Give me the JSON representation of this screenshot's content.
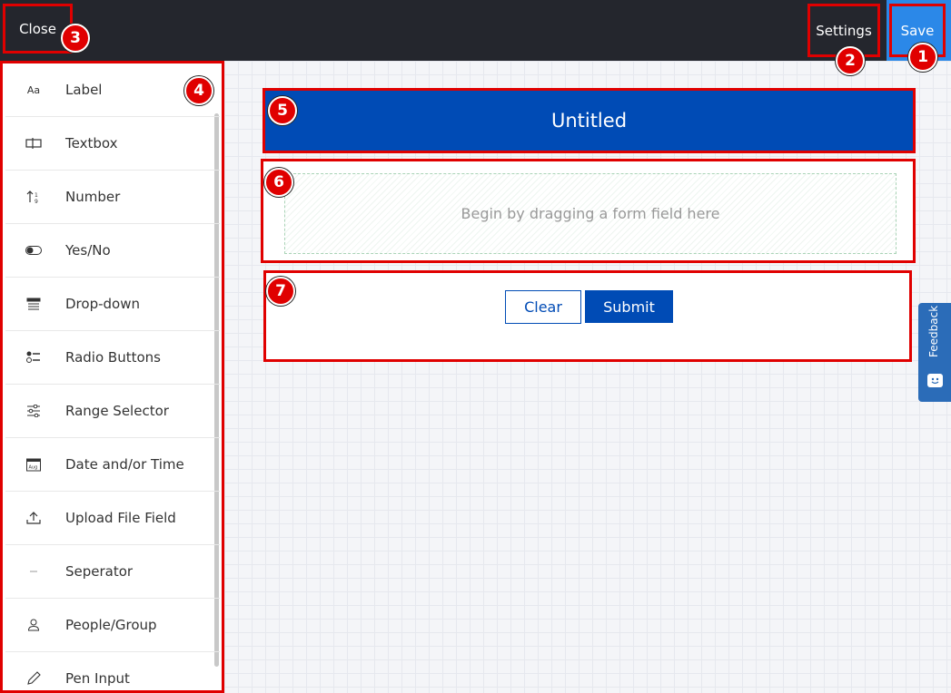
{
  "topbar": {
    "close_label": "Close",
    "settings_label": "Settings",
    "save_label": "Save"
  },
  "badges": [
    "1",
    "2",
    "3",
    "4",
    "5",
    "6",
    "7"
  ],
  "sidebar": {
    "items": [
      {
        "label": "Label",
        "icon": "text-aa-icon"
      },
      {
        "label": "Textbox",
        "icon": "textbox-icon"
      },
      {
        "label": "Number",
        "icon": "number-sort-icon"
      },
      {
        "label": "Yes/No",
        "icon": "toggle-icon"
      },
      {
        "label": "Drop-down",
        "icon": "dropdown-list-icon"
      },
      {
        "label": "Radio Buttons",
        "icon": "radio-list-icon"
      },
      {
        "label": "Range Selector",
        "icon": "sliders-icon"
      },
      {
        "label": "Date and/or Time",
        "icon": "calendar-icon"
      },
      {
        "label": "Upload File Field",
        "icon": "upload-icon"
      },
      {
        "label": "Seperator",
        "icon": "separator-icon"
      },
      {
        "label": "People/Group",
        "icon": "person-icon"
      },
      {
        "label": "Pen Input",
        "icon": "pen-icon"
      }
    ]
  },
  "form": {
    "title": "Untitled",
    "drop_hint": "Begin by dragging a form field here",
    "clear_label": "Clear",
    "submit_label": "Submit"
  },
  "feedback": {
    "label": "Feedback"
  },
  "colors": {
    "topbar": "#24262d",
    "save": "#2b88e8",
    "primary": "#004bb5",
    "annotation": "#e00000",
    "feedback": "#2b6cb8"
  }
}
